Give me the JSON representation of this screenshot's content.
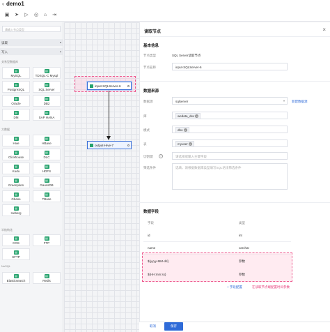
{
  "app": {
    "title": "demo1"
  },
  "sidebar": {
    "search_placeholder": "请输入节点类型",
    "sections": [
      "读取",
      "写入"
    ],
    "groups": [
      "关系型数据库",
      "大数据",
      "半结构化",
      "NoSQL"
    ],
    "tiles": [
      "MySQL",
      "TDSQL-C Mysql",
      "PostgreSQL",
      "SQL Server",
      "Oracle",
      "DB2",
      "DM",
      "SAP HANA",
      "Hive",
      "HBase",
      "Clickhouse",
      "DLC",
      "Kudu",
      "HDFS",
      "Greenplum",
      "GaussDB",
      "Gbase",
      "TBase",
      "Iceberg",
      "COS",
      "FTP",
      "SFTP",
      "Elasticsearch",
      "Redis"
    ]
  },
  "canvas": {
    "source_node": "input-SQLServer-6",
    "output_node": "output-Hive-7"
  },
  "panel": {
    "title": "读取节点",
    "close": "×",
    "basic_title": "基本信息",
    "node_type_label": "节点类型",
    "node_type_value": "SQL Server读取节点",
    "node_name_label": "节点名称",
    "node_name_value": "input-SQLServer-6",
    "source_title": "数据来源",
    "datasource_label": "数据源",
    "datasource_value": "sqlserver",
    "new_datasource_link": "新建数据源",
    "db_label": "库",
    "db_value": "wedata_dev",
    "schema_label": "模式",
    "schema_value": "dbo",
    "table_label": "表",
    "table_value": "myuser",
    "split_key_label": "切割键",
    "split_key_placeholder": "请选择或输入主键字段",
    "filter_label": "筛选条件",
    "filter_placeholder": "选填，请根据数据库类型填写SQL语法筛选条件",
    "fields_title": "数据字段",
    "col_field": "字段",
    "col_type": "类型",
    "rows": [
      {
        "field": "id",
        "type": "int"
      },
      {
        "field": "name",
        "type": "varchar"
      },
      {
        "field": "${yyyy-MM-dd}",
        "type": "参数"
      },
      {
        "field": "${HH:mm:ss}",
        "type": "参数"
      }
    ],
    "add_field_link": "+ 字段配置",
    "annotation": "在读取节点端配置时间参数",
    "cancel": "取消",
    "save": "保存"
  }
}
